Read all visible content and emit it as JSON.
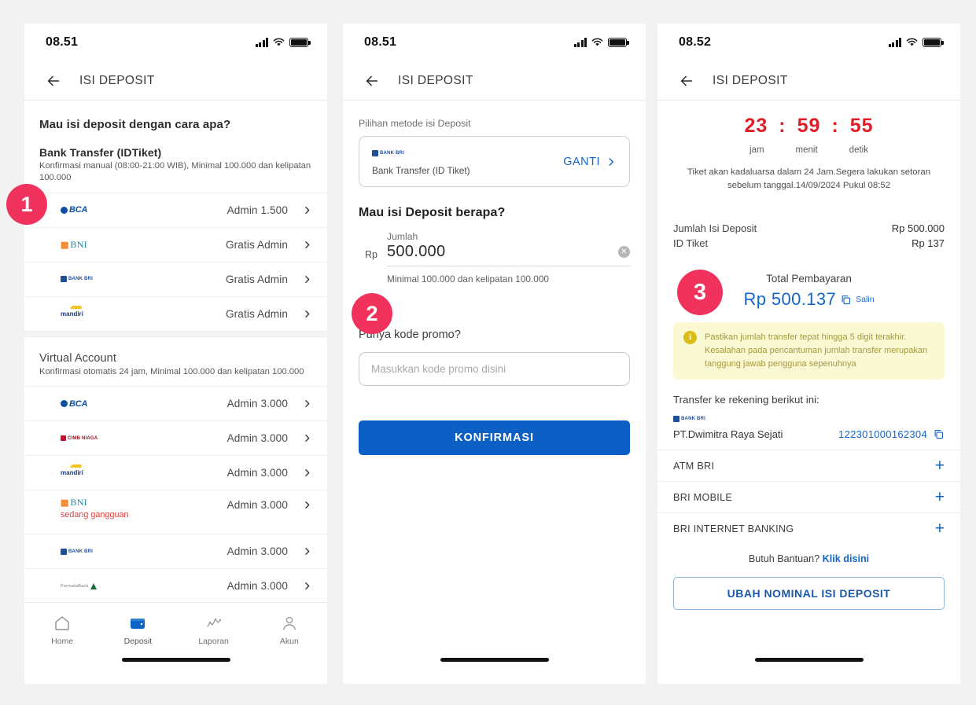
{
  "panels": {
    "p1": {
      "status": {
        "time": "08.51"
      },
      "appbar": {
        "title": "ISI DEPOSIT",
        "back_icon": "arrow-left-icon"
      },
      "heading": "Mau isi deposit dengan cara apa?",
      "groups": [
        {
          "title": "Bank Transfer (IDTiket)",
          "subtitle": "Konfirmasi manual (08:00-21:00 WIB), Minimal 100.000 dan kelipatan 100.000",
          "bold": true,
          "rows": [
            {
              "logo": "bca",
              "fee": "Admin 1.500",
              "status": ""
            },
            {
              "logo": "bni",
              "fee": "Gratis Admin",
              "status": ""
            },
            {
              "logo": "bri",
              "fee": "Gratis Admin",
              "status": ""
            },
            {
              "logo": "mandiri",
              "fee": "Gratis Admin",
              "status": ""
            }
          ]
        },
        {
          "title": "Virtual Account",
          "subtitle": "Konfirmasi otomatis 24 jam, Minimal 100.000 dan kelipatan 100.000",
          "bold": false,
          "rows": [
            {
              "logo": "bca",
              "fee": "Admin 3.000",
              "status": ""
            },
            {
              "logo": "cimb",
              "fee": "Admin 3.000",
              "status": ""
            },
            {
              "logo": "mandiri",
              "fee": "Admin 3.000",
              "status": ""
            },
            {
              "logo": "bni",
              "fee": "Admin 3.000",
              "status": "sedang gangguan"
            },
            {
              "logo": "bri",
              "fee": "Admin 3.000",
              "status": ""
            },
            {
              "logo": "permata",
              "fee": "Admin 3.000",
              "status": ""
            }
          ]
        }
      ],
      "nav": [
        {
          "label": "Home",
          "icon": "home-icon",
          "active": false
        },
        {
          "label": "Deposit",
          "icon": "wallet-icon",
          "active": true
        },
        {
          "label": "Laporan",
          "icon": "chart-icon",
          "active": false
        },
        {
          "label": "Akun",
          "icon": "person-icon",
          "active": false
        }
      ]
    },
    "p2": {
      "status": {
        "time": "08.51"
      },
      "appbar": {
        "title": "ISI DEPOSIT",
        "back_icon": "arrow-left-icon"
      },
      "method_label": "Pilihan metode isi Deposit",
      "method_logo": "bri",
      "method_name": "Bank Transfer (ID Tiket)",
      "change_label": "GANTI",
      "amount_heading": "Mau isi Deposit berapa?",
      "amount_field_label": "Jumlah",
      "currency_prefix": "Rp",
      "amount_value": "500.000",
      "amount_hint": "Minimal 100.000 dan kelipatan 100.000",
      "promo_heading": "Punya kode promo?",
      "promo_placeholder": "Masukkan kode promo disini",
      "promo_value": "",
      "confirm_label": "KONFIRMASI"
    },
    "p3": {
      "status": {
        "time": "08.52"
      },
      "appbar": {
        "title": "ISI DEPOSIT",
        "back_icon": "arrow-left-icon"
      },
      "timer": {
        "hours": "23",
        "minutes": "59",
        "seconds": "55",
        "sep": ":"
      },
      "timer_units": {
        "hours": "jam",
        "minutes": "menit",
        "seconds": "detik"
      },
      "timer_note": "Tiket akan kadaluarsa dalam 24 Jam.Segera lakukan setoran sebelum tanggal.14/09/2024 Pukul 08:52",
      "rows": [
        {
          "key": "Jumlah Isi Deposit",
          "value": "Rp 500.000"
        },
        {
          "key": "ID Tiket",
          "value": "Rp 137"
        }
      ],
      "total_label": "Total Pembayaran",
      "total_amount": "Rp 500.137",
      "copy_label": "Salin",
      "note": "Pastikan jumlah transfer tepat hingga 5 digit terakhir. Kesalahan pada pencantuman jumlah transfer merupakan tanggung jawab pengguna sepenuhnya",
      "transfer_title": "Transfer ke rekening berikut ini:",
      "account_logo": "bri",
      "account_name": "PT.Dwimitra Raya Sejati",
      "account_number": "122301000162304",
      "expand_rows": [
        {
          "label": "ATM BRI"
        },
        {
          "label": "BRI MOBILE"
        },
        {
          "label": "BRI INTERNET BANKING"
        }
      ],
      "help_text": "Butuh Bantuan? ",
      "help_link": "Klik disini",
      "change_amount_label": "UBAH NOMINAL ISI DEPOSIT"
    }
  },
  "badges": {
    "one": "1",
    "two": "2",
    "three": "3"
  },
  "colors": {
    "accent_blue": "#1266c8",
    "primary_button": "#0c5fc4",
    "badge_pink": "#f0325c",
    "timer_red": "#e01e27",
    "warning_bg": "#fbf8d4",
    "warning_text": "#a39a3e",
    "error_text": "#e0413e"
  }
}
